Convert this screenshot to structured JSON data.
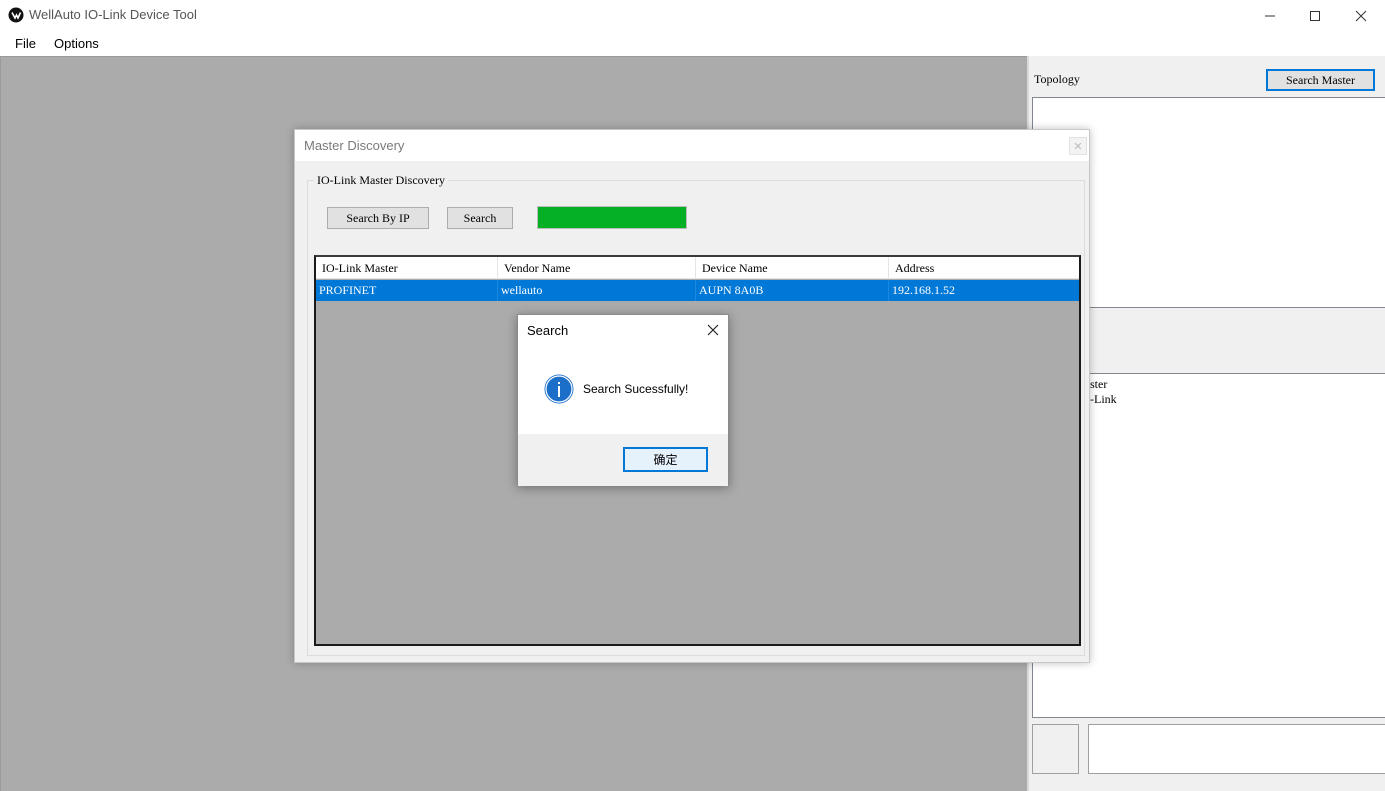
{
  "window": {
    "title": "WellAuto IO-Link Device Tool",
    "minimize_icon": "minimize-icon",
    "maximize_icon": "maximize-icon",
    "close_icon": "close-icon"
  },
  "menu": {
    "items": [
      {
        "label": "File"
      },
      {
        "label": "Options"
      }
    ]
  },
  "right_panel": {
    "topology_label": "Topology",
    "search_master_label": "Search Master",
    "tree_lines": [
      "ster",
      "-Link"
    ]
  },
  "discovery_dialog": {
    "title": "Master Discovery",
    "group_label": "IO-Link Master Discovery",
    "search_by_ip_label": "Search By IP",
    "search_label": "Search",
    "progress_percent": 100,
    "progress_color": "#06b025",
    "columns": [
      "IO-Link Master",
      "Vendor Name",
      "Device Name",
      "Address"
    ],
    "rows": [
      {
        "master": "PROFINET",
        "vendor": "wellauto",
        "device": "AUPN 8A0B",
        "address": "192.168.1.52"
      }
    ],
    "selection_color": "#0078d7"
  },
  "message_box": {
    "title": "Search",
    "message": "Search Sucessfully!",
    "icon": "info-icon",
    "ok_label": "确定"
  }
}
